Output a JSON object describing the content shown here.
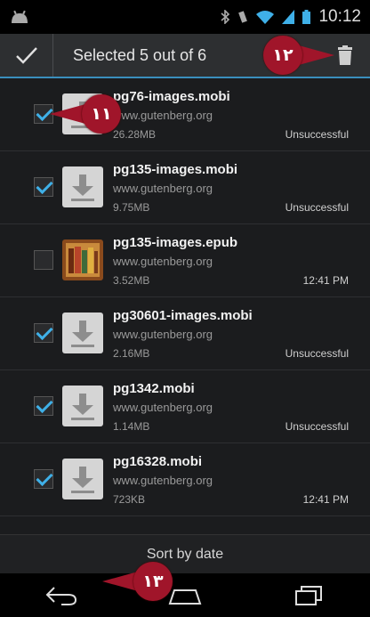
{
  "status_bar": {
    "time": "10:12"
  },
  "action_bar": {
    "title": "Selected 5 out of 6"
  },
  "downloads": [
    {
      "name": "pg76-images.mobi",
      "site": "www.gutenberg.org",
      "size": "26.28MB",
      "status": "Unsuccessful",
      "checked": true,
      "icon": "download-icon"
    },
    {
      "name": "pg135-images.mobi",
      "site": "www.gutenberg.org",
      "size": "9.75MB",
      "status": "Unsuccessful",
      "checked": true,
      "icon": "download-icon"
    },
    {
      "name": "pg135-images.epub",
      "site": "www.gutenberg.org",
      "size": "3.52MB",
      "status": "12:41 PM",
      "checked": false,
      "icon": "bookshelf-icon"
    },
    {
      "name": "pg30601-images.mobi",
      "site": "www.gutenberg.org",
      "size": "2.16MB",
      "status": "Unsuccessful",
      "checked": true,
      "icon": "download-icon"
    },
    {
      "name": "pg1342.mobi",
      "site": "www.gutenberg.org",
      "size": "1.14MB",
      "status": "Unsuccessful",
      "checked": true,
      "icon": "download-icon"
    },
    {
      "name": "pg16328.mobi",
      "site": "www.gutenberg.org",
      "size": "723KB",
      "status": "12:41 PM",
      "checked": true,
      "icon": "download-icon"
    }
  ],
  "sort_bar": {
    "label": "Sort by date"
  },
  "callouts": {
    "first": "١١",
    "second": "١٢",
    "third": "١٣"
  },
  "colors": {
    "accent": "#3fb0e8",
    "callout": "#a0152a"
  }
}
